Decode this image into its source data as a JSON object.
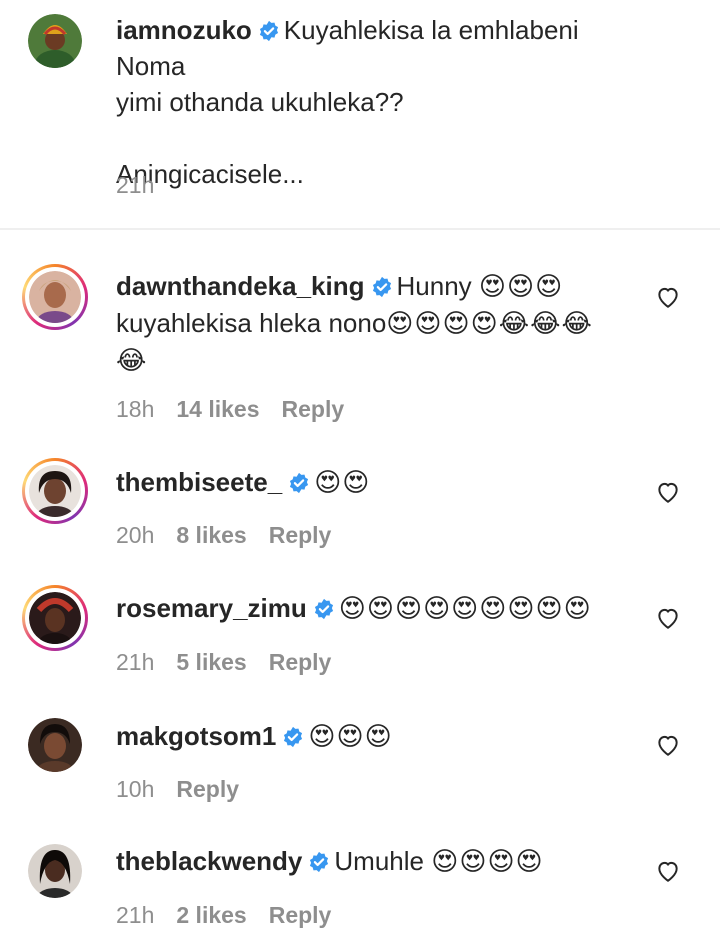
{
  "caption": {
    "username": "iamnozuko",
    "text_line1": "Kuyahlekisa la emhlabeni Noma",
    "text_line2": "yimi othanda ukuhleka??",
    "text_line3": "Aningicacisele...",
    "time": "21h"
  },
  "comments": [
    {
      "username": "dawnthandeka_king",
      "text_a": "Hunny ",
      "emoji_a": "😍😍😍",
      "text_b": "kuyahlekisa hleka nono",
      "emoji_b": "😍😍😍😍😂😂😂",
      "emoji_c": "😂",
      "time": "18h",
      "likes": "14 likes",
      "reply": "Reply"
    },
    {
      "username": "thembiseete_",
      "emoji": "😍😍",
      "time": "20h",
      "likes": "8 likes",
      "reply": "Reply"
    },
    {
      "username": "rosemary_zimu",
      "emoji": "😍😍😍😍😍😍😍😍😍",
      "time": "21h",
      "likes": "5 likes",
      "reply": "Reply"
    },
    {
      "username": "makgotsom1",
      "emoji": "😍😍😍",
      "time": "10h",
      "reply": "Reply"
    },
    {
      "username": "theblackwendy",
      "text": "Umuhle ",
      "emoji": "😍😍😍😍",
      "time": "21h",
      "likes": "2 likes",
      "reply": "Reply"
    }
  ],
  "colors": {
    "text": "#262626",
    "meta": "#8e8e8e",
    "verified": "#3897f0",
    "divider": "#efefef"
  },
  "icons": {
    "verified": "verified-badge-icon",
    "like": "heart-outline-icon"
  }
}
